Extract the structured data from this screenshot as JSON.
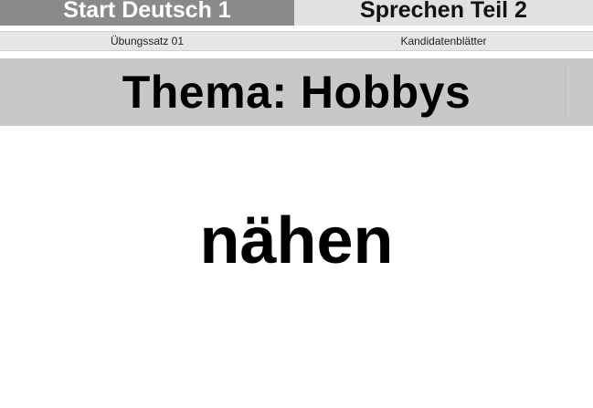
{
  "header": {
    "left_title": "Start Deutsch 1",
    "right_title": "Sprechen Teil 2"
  },
  "subheader": {
    "left": "Übungssatz 01",
    "right": "Kandidatenblätter"
  },
  "topic": {
    "label": "Thema: Hobbys"
  },
  "card": {
    "word": "nähen"
  },
  "colors": {
    "header_left_bg": "#8a8a8a",
    "header_right_bg": "#e1e1e1",
    "subheader_bg": "#e6e6e6",
    "topic_bg": "#c8c8c8",
    "page_bg": "#ffffff"
  }
}
